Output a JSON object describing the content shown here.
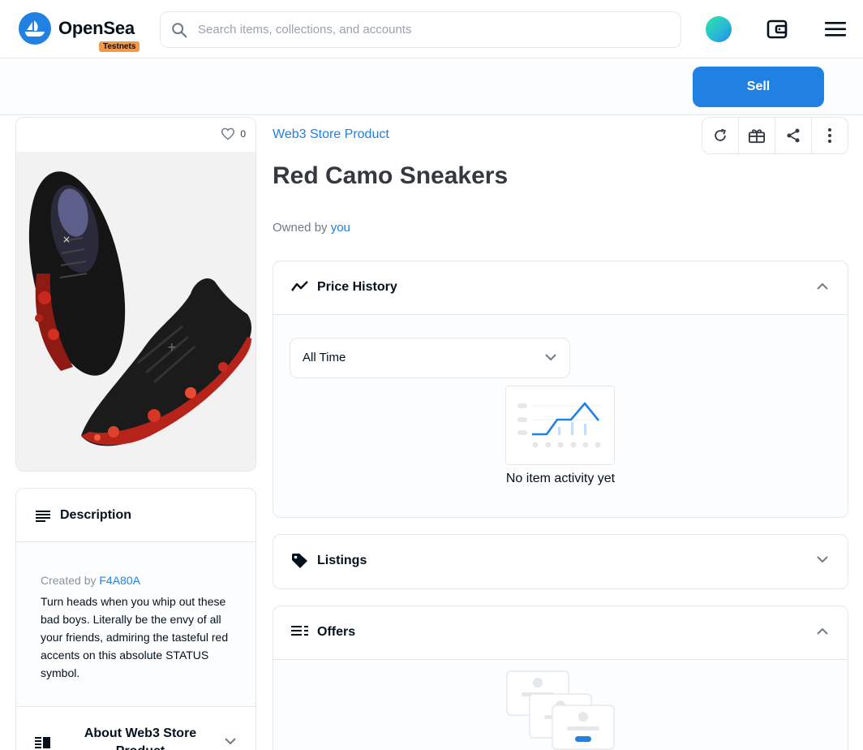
{
  "header": {
    "logo_text": "OpenSea",
    "badge": "Testnets",
    "search_placeholder": "Search items, collections, and accounts"
  },
  "sellbar": {
    "sell_label": "Sell"
  },
  "item": {
    "favorites_count": "0",
    "collection": "Web3 Store Product",
    "title": "Red Camo Sneakers",
    "owned_by_label": "Owned by",
    "owner": "you"
  },
  "description": {
    "title": "Description",
    "created_by_label": "Created by",
    "creator": "F4A80A",
    "text": "Turn heads when you whip out these bad boys. Literally be the envy of all your friends, admiring the tasteful red accents on this absolute STATUS symbol.",
    "about_title": "About Web3 Store Product"
  },
  "price_history": {
    "title": "Price History",
    "range_selected": "All Time",
    "empty_text": "No item activity yet"
  },
  "listings": {
    "title": "Listings"
  },
  "offers": {
    "title": "Offers"
  },
  "colors": {
    "accent": "#2081e2",
    "badge": "#f2994a",
    "text": "#04111d"
  }
}
